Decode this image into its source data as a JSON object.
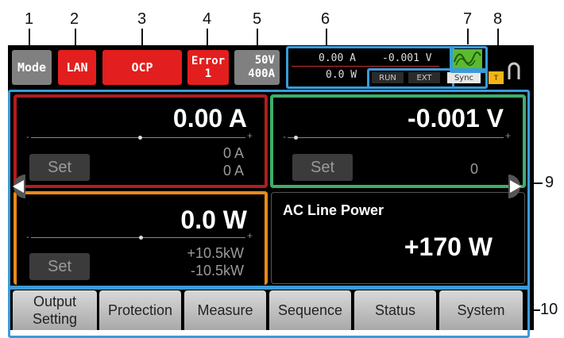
{
  "callouts": {
    "n1": "1",
    "n2": "2",
    "n3": "3",
    "n4": "4",
    "n5": "5",
    "n6": "6",
    "n7": "7",
    "n8": "8",
    "n9": "9",
    "n10": "10"
  },
  "status_bar": {
    "mode": "Mode",
    "lan": "LAN",
    "ocp": "OCP",
    "error_label": "Error",
    "error_count": "1",
    "rating_voltage": "50V",
    "rating_current": "400A",
    "monitor_current": "0.00 A",
    "monitor_voltage": "-0.001 V",
    "monitor_power": "0.0 W",
    "run": "RUN",
    "ext": "EXT",
    "sync": "Sync",
    "lock_glyph": "T"
  },
  "current_panel": {
    "value": "0.00 A",
    "set": "Set",
    "limit_high": "0 A",
    "limit_low": "0 A"
  },
  "voltage_panel": {
    "value": "-0.001 V",
    "set": "Set",
    "limit": "0"
  },
  "power_panel": {
    "value": "0.0 W",
    "set": "Set",
    "limit_high": "+10.5kW",
    "limit_low": "-10.5kW"
  },
  "ac_line_panel": {
    "title": "AC Line Power",
    "value": "+170 W"
  },
  "tabs": [
    {
      "line1": "Output",
      "line2": "Setting"
    },
    {
      "line1": "Protection",
      "line2": ""
    },
    {
      "line1": "Measure",
      "line2": ""
    },
    {
      "line1": "Sequence",
      "line2": ""
    },
    {
      "line1": "Status",
      "line2": ""
    },
    {
      "line1": "System",
      "line2": ""
    }
  ],
  "colors": {
    "current_border": "#b01e1e",
    "voltage_border": "#3fae6a",
    "power_border": "#e88a1a",
    "callout_frame": "#3a9bd9",
    "alert_red": "#e31e1e",
    "status_gray": "#808080"
  }
}
